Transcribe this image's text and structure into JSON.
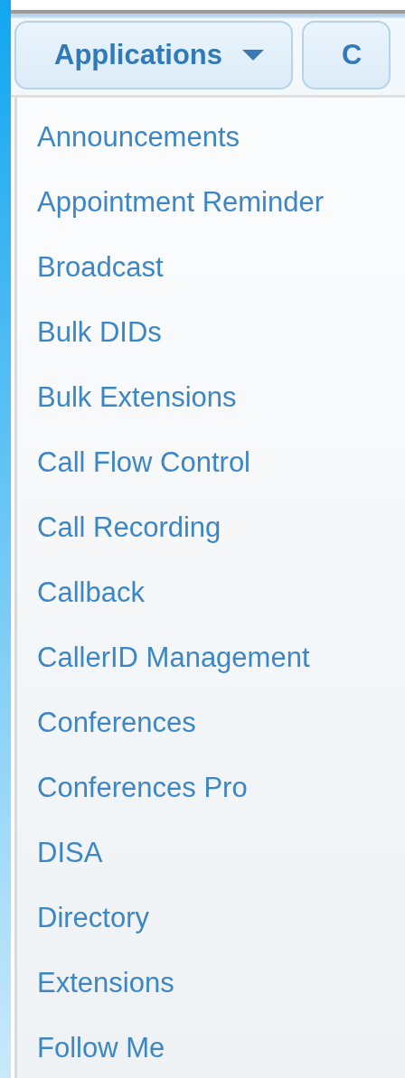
{
  "nav_buttons": [
    {
      "label": "Applications",
      "caret": true
    },
    {
      "label": "C",
      "caret": false
    }
  ],
  "dropdown": {
    "items": [
      "Announcements",
      "Appointment Reminder",
      "Broadcast",
      "Bulk DIDs",
      "Bulk Extensions",
      "Call Flow Control",
      "Call Recording",
      "Callback",
      "CallerID Management",
      "Conferences",
      "Conferences Pro",
      "DISA",
      "Directory",
      "Extensions",
      "Follow Me"
    ]
  }
}
